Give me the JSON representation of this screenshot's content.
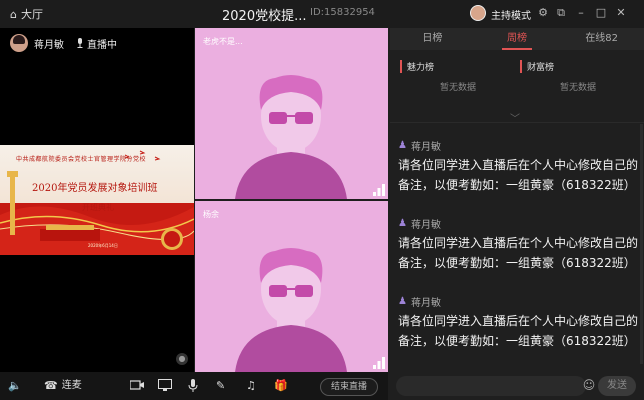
{
  "titlebar": {
    "back_label": "大厅",
    "title": "2020党校提...",
    "room_id": "ID:15832954",
    "mode_label": "主持模式"
  },
  "main_video": {
    "presenter_name": "蒋月敏",
    "live_label": "直播中",
    "slide": {
      "line1": "中共成都航院委员会党校士官管理学院分党校",
      "line2": "2020年党员发展对象培训班",
      "line3": "开班典礼",
      "date": "2020年6月14日"
    }
  },
  "video_tiles": [
    {
      "name": "老虎不是..."
    },
    {
      "name": "杨余"
    }
  ],
  "right_panel": {
    "tabs": [
      {
        "label": "日榜"
      },
      {
        "label": "周榜"
      },
      {
        "label": "在线82"
      }
    ],
    "ranks": [
      {
        "label": "魅力榜",
        "empty": "暂无数据"
      },
      {
        "label": "财富榜",
        "empty": "暂无数据"
      }
    ],
    "messages": [
      {
        "user": "蒋月敏",
        "text": "请各位同学进入直播后在个人中心修改自己的备注，以便考勤如：一组黄豪（618322班）"
      },
      {
        "user": "蒋月敏",
        "text": "请各位同学进入直播后在个人中心修改自己的备注，以便考勤如：一组黄豪（618322班）"
      },
      {
        "user": "蒋月敏",
        "text": "请各位同学进入直播后在个人中心修改自己的备注，以便考勤如：一组黄豪（618322班）"
      }
    ]
  },
  "bottombar": {
    "connect_label": "连麦",
    "end_label": "结束直播"
  },
  "input": {
    "placeholder": "",
    "send_label": "发送"
  },
  "colors": {
    "accent": "#e05454",
    "tile_bg": "#ebafe0",
    "panel_bg": "#1f1f1f"
  }
}
